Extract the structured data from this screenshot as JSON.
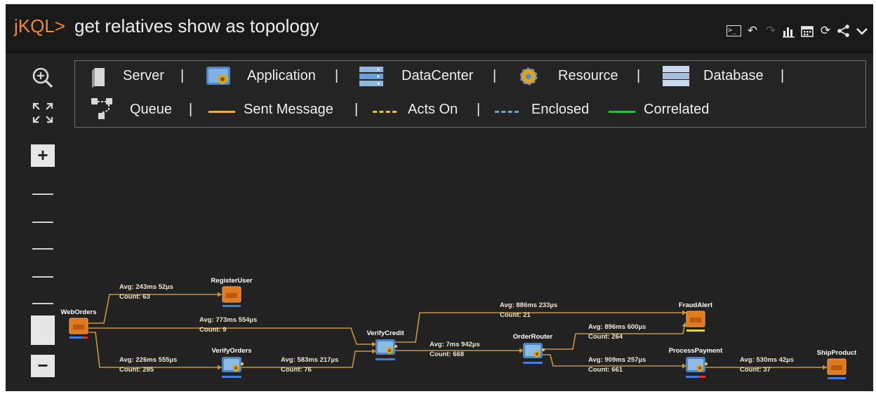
{
  "header": {
    "prompt": "jKQL>",
    "query": "get relatives show as topology",
    "toolbar_icons": [
      "terminal-icon",
      "undo-icon",
      "redo-icon",
      "bar-chart-icon",
      "calendar-icon",
      "refresh-icon",
      "share-icon",
      "chevron-down-icon"
    ]
  },
  "legend": {
    "nodes": [
      {
        "label": "Server",
        "icon": "server-icon"
      },
      {
        "label": "Application",
        "icon": "application-icon"
      },
      {
        "label": "DataCenter",
        "icon": "datacenter-icon"
      },
      {
        "label": "Resource",
        "icon": "resource-icon"
      },
      {
        "label": "Database",
        "icon": "database-icon"
      },
      {
        "label": "Queue",
        "icon": "queue-icon"
      }
    ],
    "edges": [
      {
        "label": "Sent Message",
        "color": "#e8b04a",
        "style": "solid"
      },
      {
        "label": "Acts On",
        "color": "#e8c040",
        "style": "dashed"
      },
      {
        "label": "Enclosed",
        "color": "#6aa6c8",
        "style": "dashed"
      },
      {
        "label": "Correlated",
        "color": "#22c23a",
        "style": "solid"
      }
    ]
  },
  "zoom": {
    "in_label": "+",
    "out_label": "−",
    "level_fraction": 0.25
  },
  "colors": {
    "accent": "#f08a2c",
    "edge": "#c8963c",
    "queue": "#e07a20",
    "app": "#5a9fd4",
    "status_blue": "#3f7fe0"
  },
  "topology": {
    "nodes": [
      {
        "id": "WebOrders",
        "label": "WebOrders",
        "type": "queue"
      },
      {
        "id": "RegisterUser",
        "label": "RegisterUser",
        "type": "queue"
      },
      {
        "id": "VerifyOrders",
        "label": "VerifyOrders",
        "type": "application"
      },
      {
        "id": "VerifyCredit",
        "label": "VerifyCredit",
        "type": "application"
      },
      {
        "id": "OrderRouter",
        "label": "OrderRouter",
        "type": "application"
      },
      {
        "id": "FraudAlert",
        "label": "FraudAlert",
        "type": "queue"
      },
      {
        "id": "ProcessPayment",
        "label": "ProcessPayment",
        "type": "application"
      },
      {
        "id": "ShipProduct",
        "label": "ShipProduct",
        "type": "queue"
      }
    ],
    "edges": [
      {
        "from": "WebOrders",
        "to": "RegisterUser",
        "avg": "Avg: 243ms 52µs",
        "count": "Count: 63"
      },
      {
        "from": "WebOrders",
        "to": "VerifyCredit",
        "avg": "Avg: 773ms 554µs",
        "count": "Count: 9"
      },
      {
        "from": "WebOrders",
        "to": "VerifyOrders",
        "avg": "Avg: 226ms 555µs",
        "count": "Count: 285"
      },
      {
        "from": "VerifyOrders",
        "to": "VerifyCredit",
        "avg": "Avg: 583ms 217µs",
        "count": "Count: 76"
      },
      {
        "from": "VerifyCredit",
        "to": "FraudAlert",
        "avg": "Avg: 886ms 233µs",
        "count": "Count: 21"
      },
      {
        "from": "VerifyCredit",
        "to": "OrderRouter",
        "avg": "Avg: 7ms 942µs",
        "count": "Count: 668"
      },
      {
        "from": "OrderRouter",
        "to": "FraudAlert",
        "avg": "Avg: 896ms 600µs",
        "count": "Count: 264"
      },
      {
        "from": "OrderRouter",
        "to": "ProcessPayment",
        "avg": "Avg: 909ms 257µs",
        "count": "Count: 661"
      },
      {
        "from": "ProcessPayment",
        "to": "ShipProduct",
        "avg": "Avg: 530ms 42µs",
        "count": "Count: 37"
      }
    ]
  }
}
